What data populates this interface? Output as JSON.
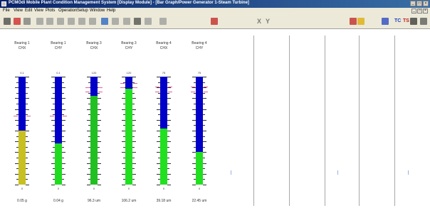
{
  "window": {
    "title": "PCMOdi Mobile Plant Condition Management System [Display Module] - [Bar Graph/Power Generator 1-Steam Turbine]",
    "controls": [
      "_",
      "□",
      "×"
    ],
    "mdi_controls": [
      "_",
      "□",
      "×"
    ]
  },
  "menu": [
    "File",
    "View",
    "Edit",
    "View",
    "Plots",
    "Operation",
    "Setup",
    "Window",
    "Help"
  ],
  "toolbar": {
    "items": [
      {
        "icon": "stop-icon",
        "color": "#444444"
      },
      {
        "icon": "record-icon",
        "color": "#cc2222"
      },
      {
        "icon": "pause-icon",
        "color": "#7a7a7a"
      },
      {
        "icon": "zoom-icon",
        "color": "#9a9a9a"
      },
      {
        "icon": "cursor-icon",
        "color": "#9a9a9a"
      },
      {
        "icon": "line-icon",
        "color": "#9a9a9a"
      },
      {
        "icon": "grid-icon",
        "color": "#9a9a9a"
      },
      {
        "icon": "hand-icon",
        "color": "#9a9a9a"
      },
      {
        "icon": "rect-icon",
        "color": "#9a9a9a"
      },
      {
        "icon": "bars-icon",
        "color": "#2060c0"
      },
      {
        "icon": "trend-icon",
        "color": "#9a9a9a"
      },
      {
        "icon": "arrows-icon",
        "color": "#9a9a9a"
      },
      {
        "icon": "move-icon",
        "color": "#4a4a4a"
      },
      {
        "icon": "select-icon",
        "color": "#9a9a9a"
      },
      {
        "icon": "table-icon",
        "color": "#9a9a9a"
      },
      {
        "icon": "bar-chart-icon",
        "color": "#c02020"
      },
      {
        "icon": "pen-icon",
        "color": "#c02020"
      },
      {
        "icon": "star-icon",
        "color": "#ddaa00"
      },
      {
        "icon": "ts-icon",
        "color": "#2040c0"
      },
      {
        "icon": "save-icon",
        "color": "#333333"
      },
      {
        "icon": "print-icon",
        "color": "#555555"
      }
    ],
    "labels": {
      "x": "X",
      "y": "Y",
      "tc": "TC",
      "ts": "TS"
    }
  },
  "bars": [
    {
      "name": "Bearing 1",
      "unit": "CHX",
      "max": "0.1",
      "min": "0",
      "reading": "0.05 g",
      "fill_fraction": 0.5,
      "fill_color": "#c8c020",
      "alarm": [
        0.64
      ]
    },
    {
      "name": "Bearing 1",
      "unit": "CHY",
      "max": "0.1",
      "min": "0",
      "reading": "0.04 g",
      "fill_fraction": 0.38,
      "fill_color": "#20dc20",
      "alarm": [
        0.64
      ]
    },
    {
      "name": "Bearing 3",
      "unit": "CHX",
      "max": "120",
      "min": "0",
      "reading": "96.3 um",
      "fill_fraction": 0.82,
      "fill_color": "#20c020",
      "alarm": [
        0.9,
        0.86
      ]
    },
    {
      "name": "Bearing 3",
      "unit": "CHY",
      "max": "120",
      "min": "0",
      "reading": "106.2 um",
      "fill_fraction": 0.89,
      "fill_color": "#20e020",
      "alarm": [
        0.94,
        0.9
      ]
    },
    {
      "name": "Bearing 4",
      "unit": "CHX",
      "max": "75",
      "min": "0",
      "reading": "39.18 um",
      "fill_fraction": 0.52,
      "fill_color": "#20e020",
      "alarm": [
        0.91,
        0.86
      ]
    },
    {
      "name": "Bearing 4",
      "unit": "CHY",
      "max": "75",
      "min": "0",
      "reading": "22.45 um",
      "fill_fraction": 0.3,
      "fill_color": "#20e020",
      "alarm": [
        0.91,
        0.86
      ]
    }
  ]
}
